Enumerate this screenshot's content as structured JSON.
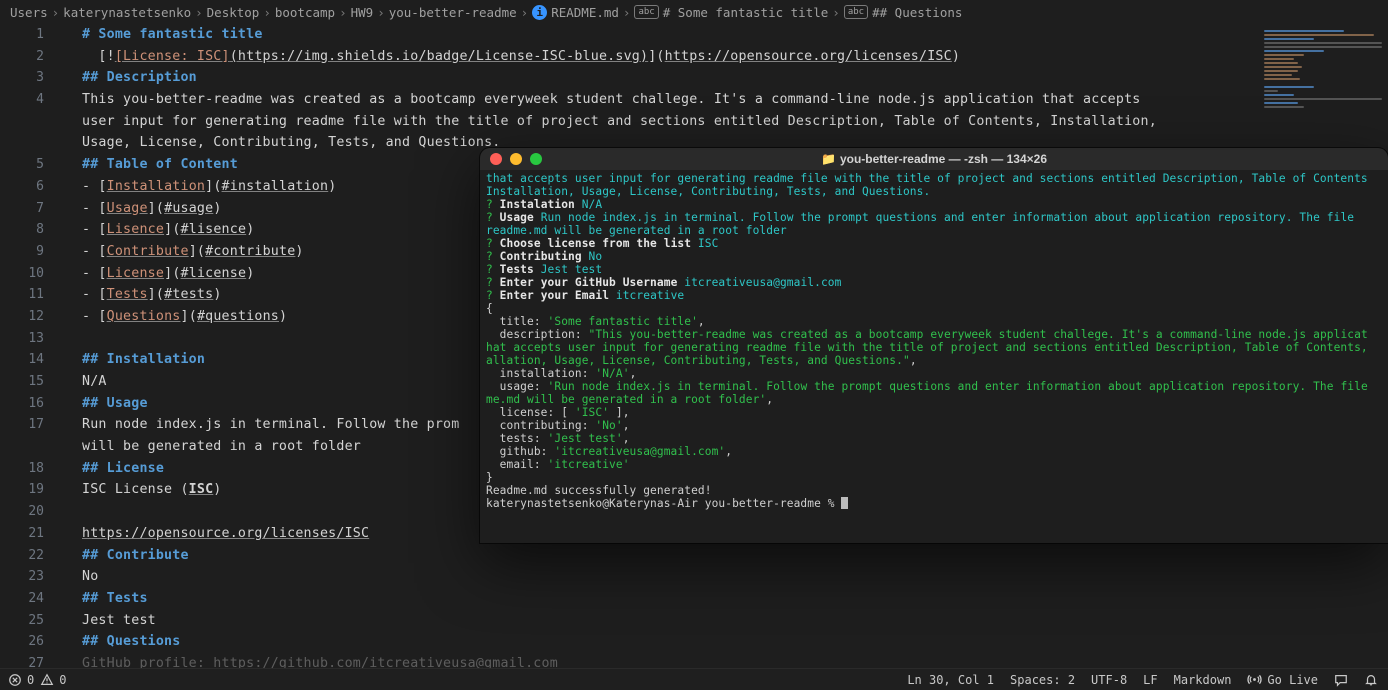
{
  "breadcrumb": {
    "parts": [
      "Users",
      "katerynastetsenko",
      "Desktop",
      "bootcamp",
      "HW9",
      "you-better-readme"
    ],
    "file": "README.md",
    "sym1": "# Some fantastic title",
    "sym2": "## Questions",
    "chip": "abc"
  },
  "editor": {
    "lines": [
      {
        "n": 1,
        "h": "# Some fantastic title"
      },
      {
        "n": 2,
        "raw": "  [!",
        "lbl": "[License: ISC]",
        "url1": "(https://img.shields.io/badge/License-ISC-blue.svg)",
        "mid": "](",
        "url2": "https://opensource.org/licenses/ISC",
        "end": ")"
      },
      {
        "n": 3,
        "h": "## Description"
      },
      {
        "n": 4,
        "p": "This you-better-readme was created as a bootcamp everyweek student challege. It's a command-line node.js application that accepts"
      },
      {
        "n": 0,
        "p": "user input for generating readme file with the title of project and sections entitled Description, Table of Contents, Installation,"
      },
      {
        "n": 0,
        "p": "Usage, License, Contributing, Tests, and Questions."
      },
      {
        "n": 5,
        "h": "## Table of Content"
      },
      {
        "n": 6,
        "toc_label": "Installation",
        "toc_anchor": "#installation"
      },
      {
        "n": 7,
        "toc_label": "Usage",
        "toc_anchor": "#usage"
      },
      {
        "n": 8,
        "toc_label": "Lisence",
        "toc_anchor": "#lisence"
      },
      {
        "n": 9,
        "toc_label": "Contribute",
        "toc_anchor": "#contribute"
      },
      {
        "n": 10,
        "toc_label": "License",
        "toc_anchor": "#license"
      },
      {
        "n": 11,
        "toc_label": "Tests",
        "toc_anchor": "#tests"
      },
      {
        "n": 12,
        "toc_label": "Questions",
        "toc_anchor": "#questions"
      },
      {
        "n": 13,
        "blank": true
      },
      {
        "n": 14,
        "h": "## Installation"
      },
      {
        "n": 15,
        "p": "N/A"
      },
      {
        "n": 16,
        "h": "## Usage"
      },
      {
        "n": 17,
        "p": "Run node index.js in terminal. Follow the prom"
      },
      {
        "n": 0,
        "p": "will be generated in a root folder"
      },
      {
        "n": 18,
        "h": "## License"
      },
      {
        "n": 19,
        "lic_pre": "ISC License (",
        "lic_bold": "ISC",
        "lic_post": ")"
      },
      {
        "n": 20,
        "blank": true
      },
      {
        "n": 21,
        "link": "https://opensource.org/licenses/ISC"
      },
      {
        "n": 22,
        "h": "## Contribute"
      },
      {
        "n": 23,
        "p": "No"
      },
      {
        "n": 24,
        "h": "## Tests"
      },
      {
        "n": 25,
        "p": "Jest test"
      },
      {
        "n": 26,
        "h": "## Questions"
      },
      {
        "n": 27,
        "p_dim": "GitHub profile: https://github.com/itcreativeusa@gmail.com"
      }
    ]
  },
  "terminal": {
    "title": "you-better-readme — -zsh — 134×26",
    "lines": [
      {
        "cls": "tc-cyan",
        "text": "that accepts user input for generating readme file with the title of project and sections entitled Description, Table of Contents"
      },
      {
        "cls": "tc-cyan",
        "text": "Installation, Usage, License, Contributing, Tests, and Questions."
      },
      {
        "prefix": "?",
        "label": " Instalation ",
        "ans": "N/A"
      },
      {
        "prefix": "?",
        "label": " Usage ",
        "ans": "Run node index.js in terminal. Follow the prompt questions and enter information about application repository. The file"
      },
      {
        "cls": "tc-cyan",
        "text": "readme.md will be generated in a root folder"
      },
      {
        "prefix": "?",
        "label": " Choose license from the list ",
        "ans": "ISC"
      },
      {
        "prefix": "?",
        "label": " Contributing ",
        "ans": "No"
      },
      {
        "prefix": "?",
        "label": " Tests ",
        "ans": "Jest test"
      },
      {
        "prefix": "?",
        "label": " Enter your GitHub Username ",
        "ans": "itcreativeusa@gmail.com"
      },
      {
        "prefix": "?",
        "label": " Enter your Email ",
        "ans": "itcreative"
      },
      {
        "cls": "tc-plain",
        "text": "{"
      },
      {
        "kv_key": "  title: ",
        "kv_val": "'Some fantastic title'",
        "comma": ","
      },
      {
        "kv_key": "  description: ",
        "kv_val": "\"This you-better-readme was created as a bootcamp everyweek student challege. It's a command-line node.js applicat"
      },
      {
        "cls": "tc-green",
        "text": "hat accepts user input for generating readme file with the title of project and sections entitled Description, Table of Contents,"
      },
      {
        "cls": "tc-green",
        "text": "allation, Usage, License, Contributing, Tests, and Questions.\"",
        "comma": ","
      },
      {
        "kv_key": "  installation: ",
        "kv_val": "'N/A'",
        "comma": ","
      },
      {
        "kv_key": "  usage: ",
        "kv_val": "'Run node index.js in terminal. Follow the prompt questions and enter information about application repository. The file"
      },
      {
        "cls": "tc-green",
        "text": "me.md will be generated in a root folder'",
        "comma": ","
      },
      {
        "kv_key": "  license: [ ",
        "kv_val": "'ISC'",
        "kv_post": " ]",
        "comma": ","
      },
      {
        "kv_key": "  contributing: ",
        "kv_val": "'No'",
        "comma": ","
      },
      {
        "kv_key": "  tests: ",
        "kv_val": "'Jest test'",
        "comma": ","
      },
      {
        "kv_key": "  github: ",
        "kv_val": "'itcreativeusa@gmail.com'",
        "comma": ","
      },
      {
        "kv_key": "  email: ",
        "kv_val": "'itcreative'"
      },
      {
        "cls": "tc-plain",
        "text": "}"
      },
      {
        "cls": "tc-plain",
        "text": "Readme.md successfully generated!"
      },
      {
        "prompt": "katerynastetsenko@Katerynas-Air you-better-readme % "
      }
    ]
  },
  "statusbar": {
    "errors": "0",
    "warnings": "0",
    "lncol": "Ln 30, Col 1",
    "spaces": "Spaces: 2",
    "encoding": "UTF-8",
    "eol": "LF",
    "lang": "Markdown",
    "golive": "Go Live"
  }
}
